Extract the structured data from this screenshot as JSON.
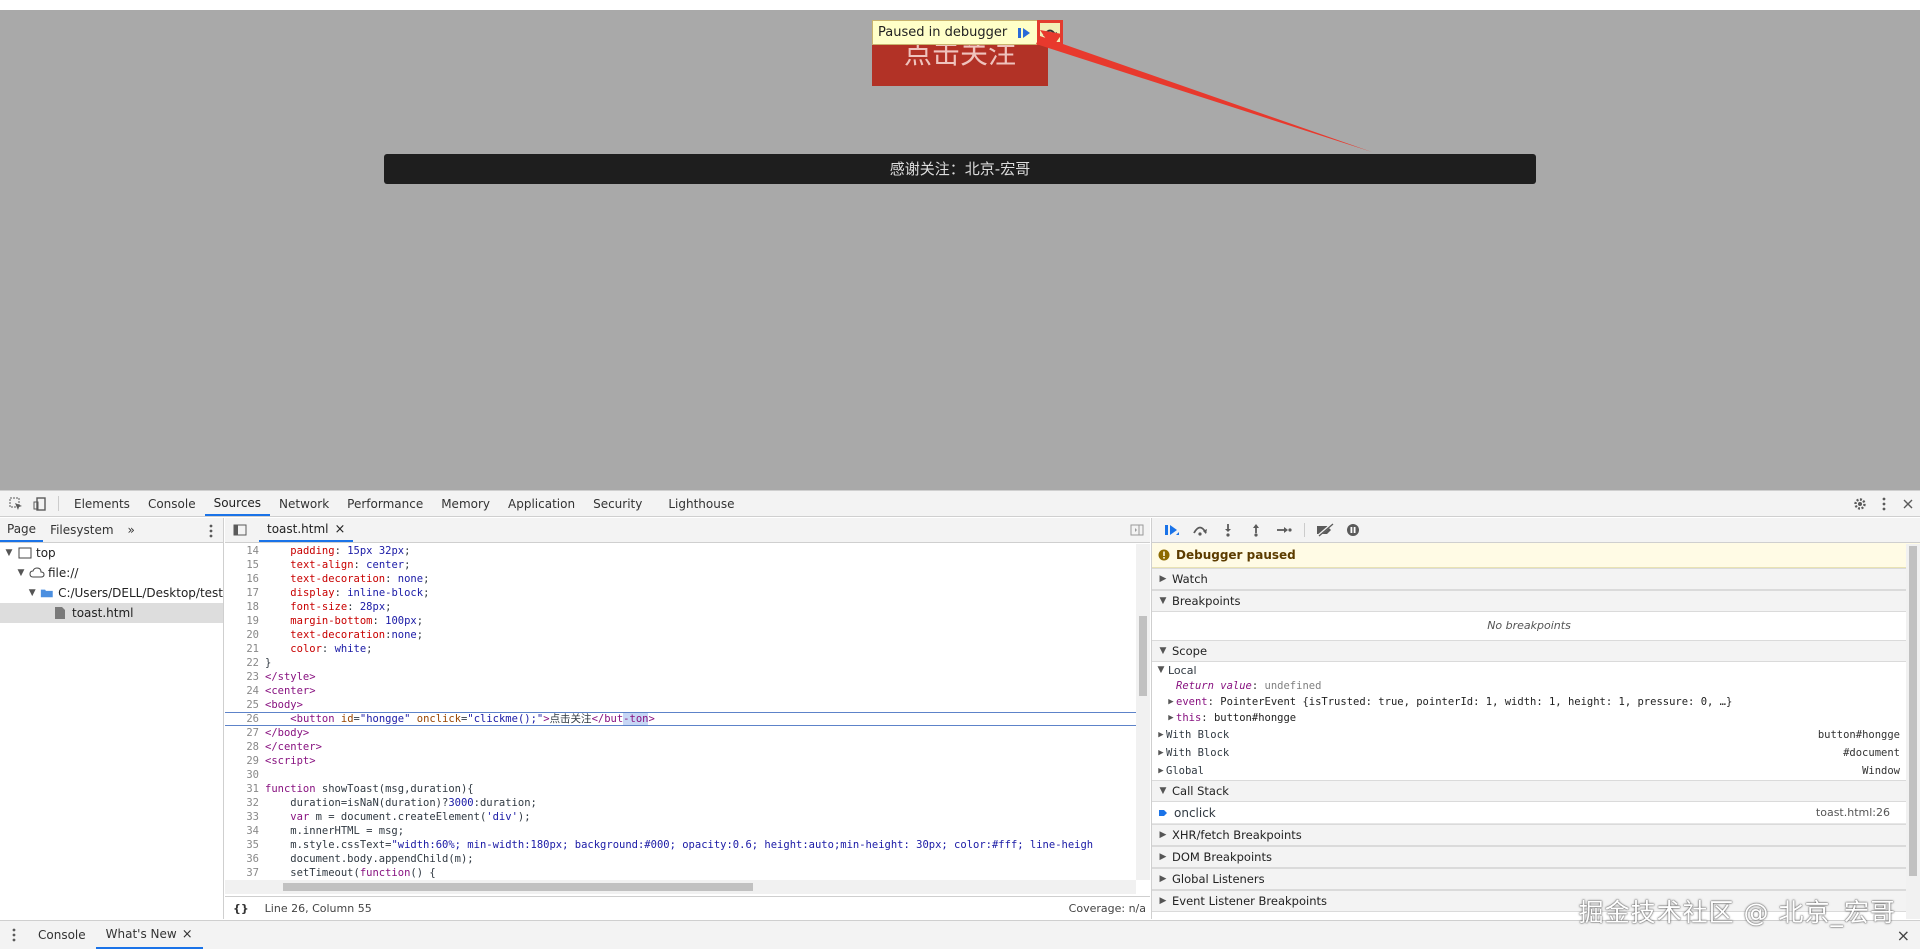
{
  "page": {
    "button_label": "点击关注",
    "toast_text": "感谢关注：北京-宏哥",
    "paused_banner": "Paused in debugger"
  },
  "devtools": {
    "tabs": [
      "Elements",
      "Console",
      "Sources",
      "Network",
      "Performance",
      "Memory",
      "Application",
      "Security",
      "Lighthouse"
    ],
    "active_tab": "Sources",
    "navigator": {
      "tabs": [
        "Page",
        "Filesystem"
      ],
      "more": "»",
      "tree": {
        "top": "top",
        "origin": "file://",
        "folder": "C:/Users/DELL/Desktop/test",
        "file": "toast.html"
      }
    },
    "editor": {
      "file_tab": "toast.html",
      "close": "×",
      "lines": [
        {
          "n": "14",
          "html": "    <span class='c-prop'>padding</span>: <span class='c-val'>15px 32px</span>;"
        },
        {
          "n": "15",
          "html": "    <span class='c-prop'>text-align</span>: <span class='c-val'>center</span>;"
        },
        {
          "n": "16",
          "html": "    <span class='c-prop'>text-decoration</span>: <span class='c-val'>none</span>;"
        },
        {
          "n": "17",
          "html": "    <span class='c-prop'>display</span>: <span class='c-val'>inline-block</span>;"
        },
        {
          "n": "18",
          "html": "    <span class='c-prop'>font-size</span>: <span class='c-val'>28px</span>;"
        },
        {
          "n": "19",
          "html": "    <span class='c-prop'>margin-bottom</span>: <span class='c-val'>100px</span>;"
        },
        {
          "n": "20",
          "html": "    <span class='c-prop'>text-decoration</span>:<span class='c-val'>none</span>;"
        },
        {
          "n": "21",
          "html": "    <span class='c-prop'>color</span>: <span class='c-val'>white</span>;"
        },
        {
          "n": "22",
          "html": "}"
        },
        {
          "n": "23",
          "html": "<span class='c-tag'>&lt;/style&gt;</span>"
        },
        {
          "n": "24",
          "html": "<span class='c-tag'>&lt;center&gt;</span>"
        },
        {
          "n": "25",
          "html": "<span class='c-tag'>&lt;body&gt;</span>"
        },
        {
          "n": "26",
          "html": "    <span class='c-tag'>&lt;button</span> <span class='c-attr'>id</span>=<span class='c-str'>\"hongge\"</span> <span class='c-attr'>onclick</span>=<span class='c-str'>\"clickme();\"</span><span class='c-tag'>&gt;</span>点击关注<span class='c-tag'>&lt;/but</span><span class='c-tag' style='background:#c7d6f5'>-ton</span><span class='c-tag'>&gt;</span>",
          "current": true
        },
        {
          "n": "27",
          "html": "<span class='c-tag'>&lt;/body&gt;</span>"
        },
        {
          "n": "28",
          "html": "<span class='c-tag'>&lt;/center&gt;</span>"
        },
        {
          "n": "29",
          "html": "<span class='c-tag'>&lt;script&gt;</span>"
        },
        {
          "n": "30",
          "html": ""
        },
        {
          "n": "31",
          "html": "<span class='c-kw'>function</span> showToast(msg,duration){"
        },
        {
          "n": "32",
          "html": "    duration=isNaN(duration)?<span class='c-val'>3000</span>:duration;"
        },
        {
          "n": "33",
          "html": "    <span class='c-kw'>var</span> m = document.createElement(<span class='c-str'>'div'</span>);"
        },
        {
          "n": "34",
          "html": "    m.innerHTML = msg;"
        },
        {
          "n": "35",
          "html": "    m.style.cssText=<span class='c-str'>\"width:60%; min-width:180px; background:#000; opacity:0.6; height:auto;min-height: 30px; color:#fff; line-heigh</span>"
        },
        {
          "n": "36",
          "html": "    document.body.appendChild(m);"
        },
        {
          "n": "37",
          "html": "    setTimeout(<span class='c-kw'>function</span>() {"
        },
        {
          "n": "38",
          "html": ""
        }
      ],
      "status_left": "Line 26, Column 55",
      "status_right": "Coverage: n/a",
      "format_icon": "{}"
    },
    "debugger": {
      "paused_message": "Debugger paused",
      "watch": "Watch",
      "breakpoints": "Breakpoints",
      "no_breakpoints": "No breakpoints",
      "scope": "Scope",
      "local": "Local",
      "return_value_key": "Return value",
      "return_value": "undefined",
      "event_key": "event",
      "event_value": "PointerEvent {isTrusted: true, pointerId: 1, width: 1, height: 1, pressure: 0, …}",
      "this_key": "this",
      "this_value": "button#hongge",
      "with_block_1": "With Block",
      "with_block_1_value": "button#hongge",
      "with_block_2": "With Block",
      "with_block_2_value": "#document",
      "global": "Global",
      "global_value": "Window",
      "call_stack": "Call Stack",
      "frame_name": "onclick",
      "frame_location": "toast.html:26",
      "xhr": "XHR/fetch Breakpoints",
      "dom": "DOM Breakpoints",
      "global_listeners": "Global Listeners",
      "event_listener": "Event Listener Breakpoints"
    },
    "drawer": {
      "tabs": [
        "Console",
        "What's New"
      ],
      "active": "What's New",
      "close": "×"
    }
  },
  "watermark": "掘金技术社区 @ 北京_宏哥",
  "colors": {
    "accent": "#1a73e8",
    "page_bg": "#a9a9a9",
    "button_bg": "#b23226",
    "highlight_red": "#e33b2e"
  }
}
